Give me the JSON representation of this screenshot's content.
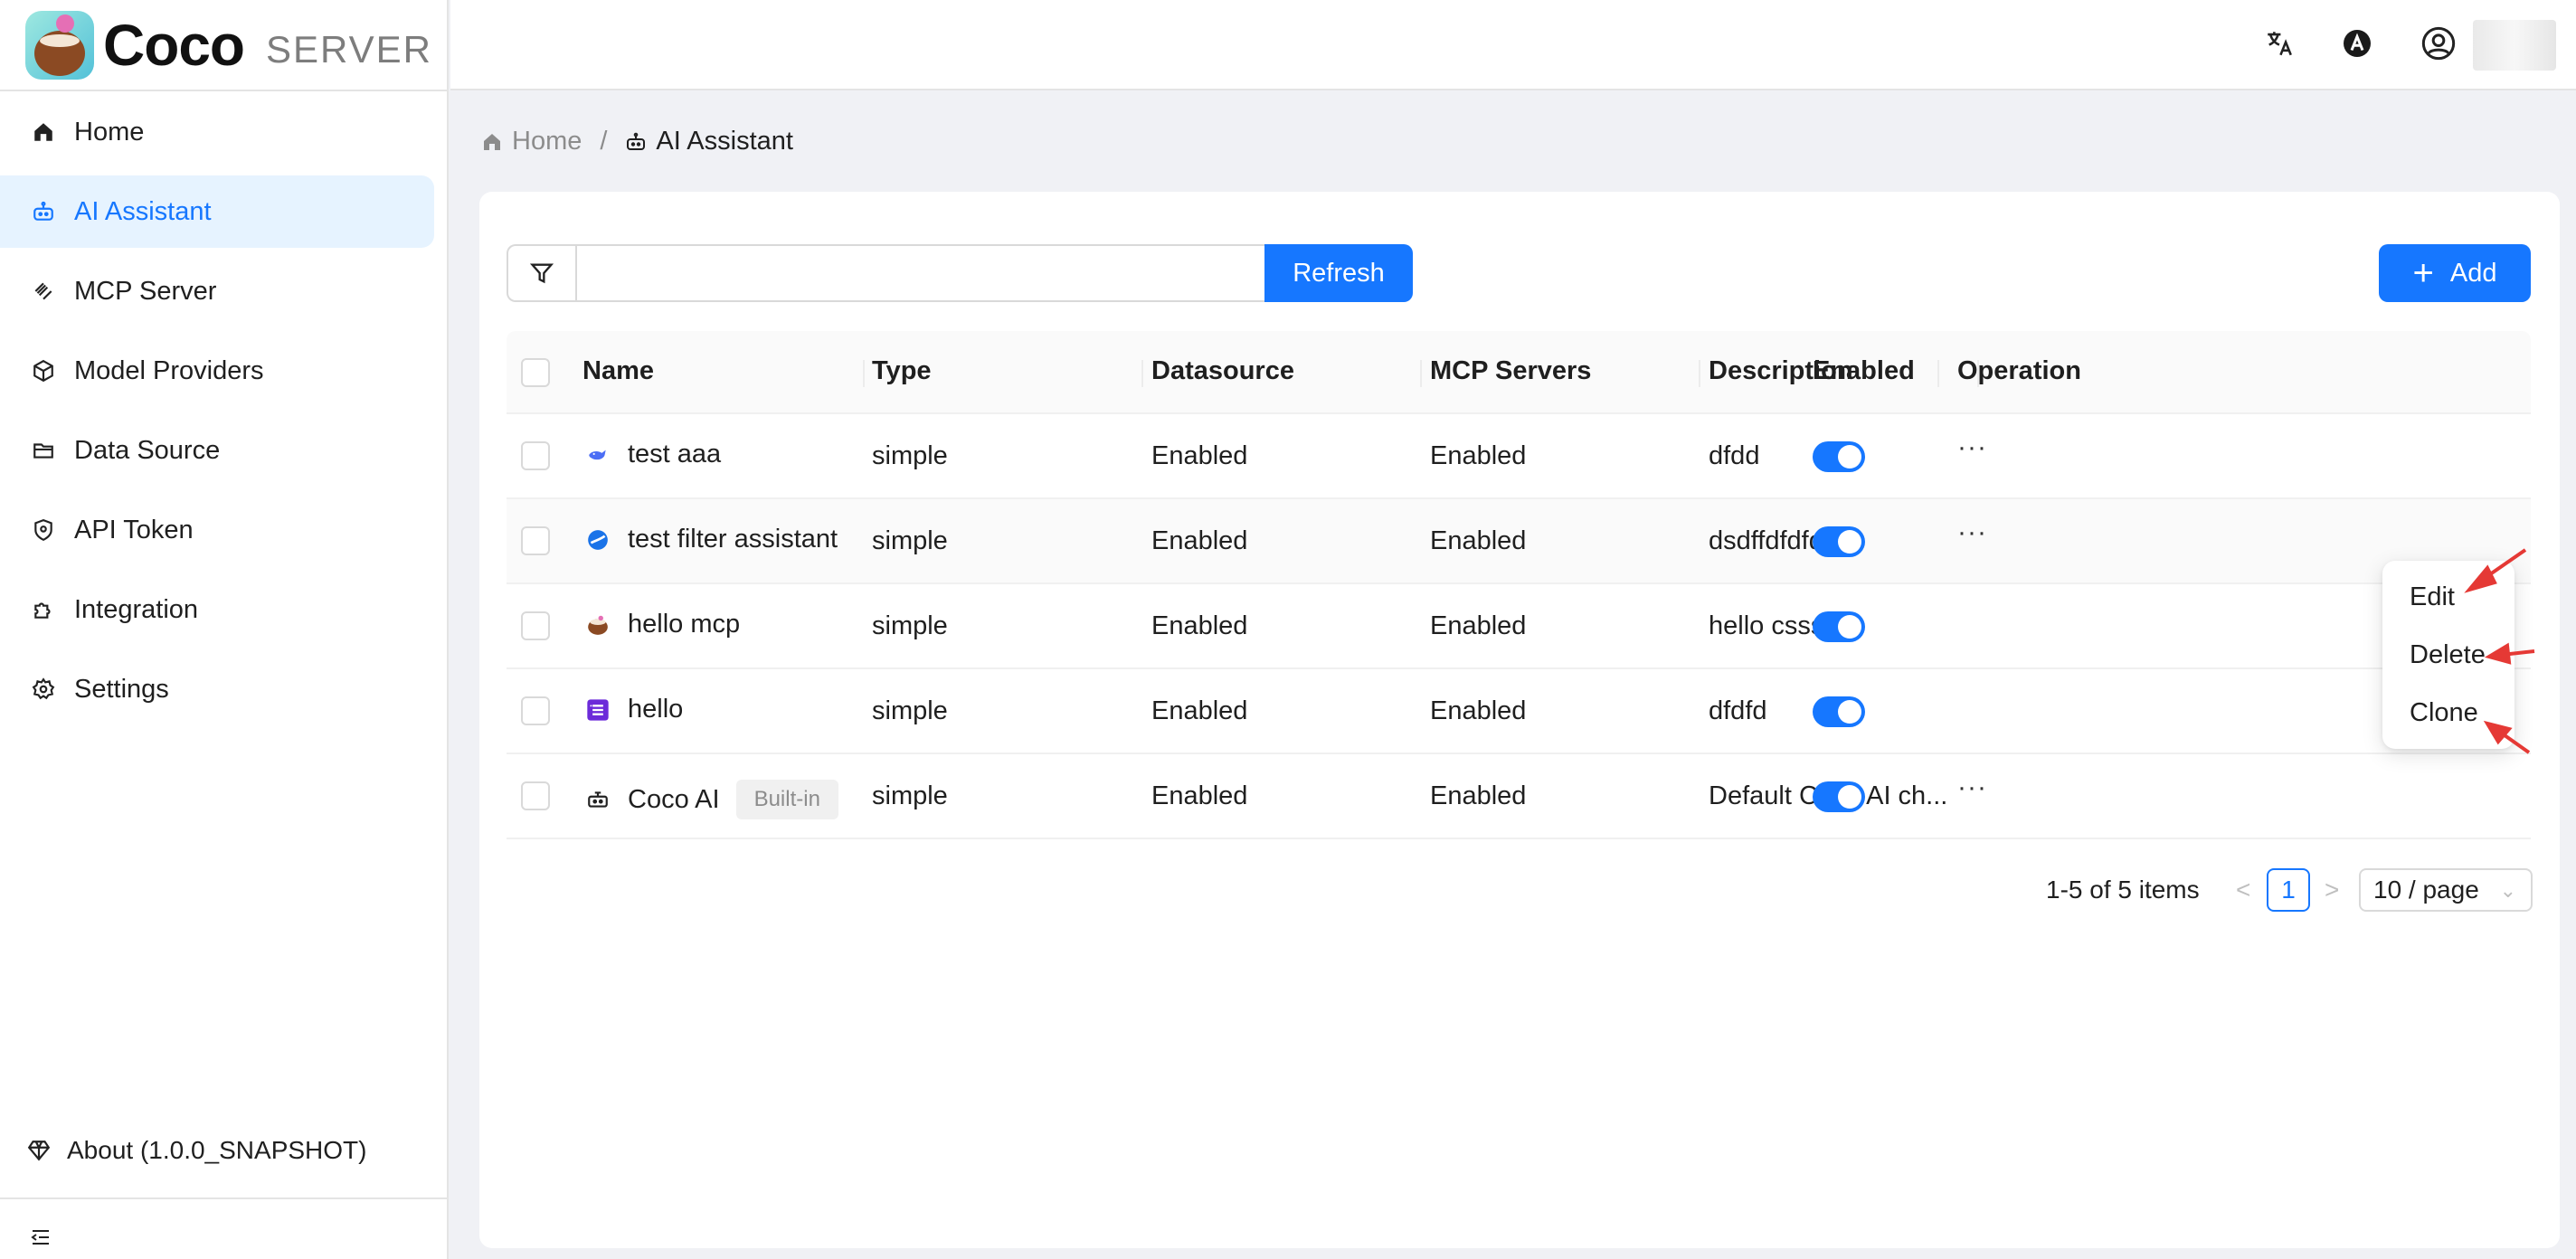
{
  "app": {
    "logo_text": "Coco",
    "logo_sub": "SERVER"
  },
  "sidebar": {
    "items": [
      {
        "label": "Home",
        "icon": "home-icon"
      },
      {
        "label": "AI Assistant",
        "icon": "robot-icon",
        "active": true
      },
      {
        "label": "MCP Server",
        "icon": "mcp-icon"
      },
      {
        "label": "Model Providers",
        "icon": "cube-icon"
      },
      {
        "label": "Data Source",
        "icon": "folder-icon"
      },
      {
        "label": "API Token",
        "icon": "shield-icon"
      },
      {
        "label": "Integration",
        "icon": "puzzle-icon"
      },
      {
        "label": "Settings",
        "icon": "gear-icon"
      }
    ],
    "about": "About (1.0.0_SNAPSHOT)"
  },
  "header": {
    "icons": [
      "translate-icon",
      "theme-icon",
      "user-icon"
    ]
  },
  "breadcrumb": {
    "home": "Home",
    "separator": "/",
    "current": "AI Assistant"
  },
  "toolbar": {
    "search_value": "",
    "refresh_label": "Refresh",
    "add_label": "Add"
  },
  "table": {
    "columns": [
      "Name",
      "Type",
      "Datasource",
      "MCP Servers",
      "Description",
      "Enabled",
      "Operation"
    ],
    "rows": [
      {
        "name": "test aaa",
        "icon": "whale-icon",
        "type": "simple",
        "datasource": "Enabled",
        "mcp": "Enabled",
        "description": "dfdd",
        "enabled": true,
        "ops": "···"
      },
      {
        "name": "test filter assistant",
        "icon": "blue-sphere-icon",
        "type": "simple",
        "datasource": "Enabled",
        "mcp": "Enabled",
        "description": "dsdffdfdfd",
        "enabled": true,
        "ops": "···"
      },
      {
        "name": "hello mcp",
        "icon": "coconut-icon",
        "type": "simple",
        "datasource": "Enabled",
        "mcp": "Enabled",
        "description": "hello csssd",
        "enabled": true,
        "ops": "···"
      },
      {
        "name": "hello",
        "icon": "purple-list-icon",
        "type": "simple",
        "datasource": "Enabled",
        "mcp": "Enabled",
        "description": "dfdfd",
        "enabled": true,
        "ops": "···"
      },
      {
        "name": "Coco AI",
        "icon": "robot-icon",
        "tag": "Built-in",
        "type": "simple",
        "datasource": "Enabled",
        "mcp": "Enabled",
        "description": "Default Coco AI ch...",
        "enabled": true,
        "ops": "···"
      }
    ]
  },
  "pagination": {
    "total": "1-5 of 5 items",
    "prev": "<",
    "next": ">",
    "current": "1",
    "page_size": "10 / page"
  },
  "menu": {
    "items": [
      "Edit",
      "Delete",
      "Clone"
    ]
  },
  "colors": {
    "primary": "#1677ff",
    "active_bg": "#e6f3ff",
    "annotation_arrow": "#e53935"
  }
}
